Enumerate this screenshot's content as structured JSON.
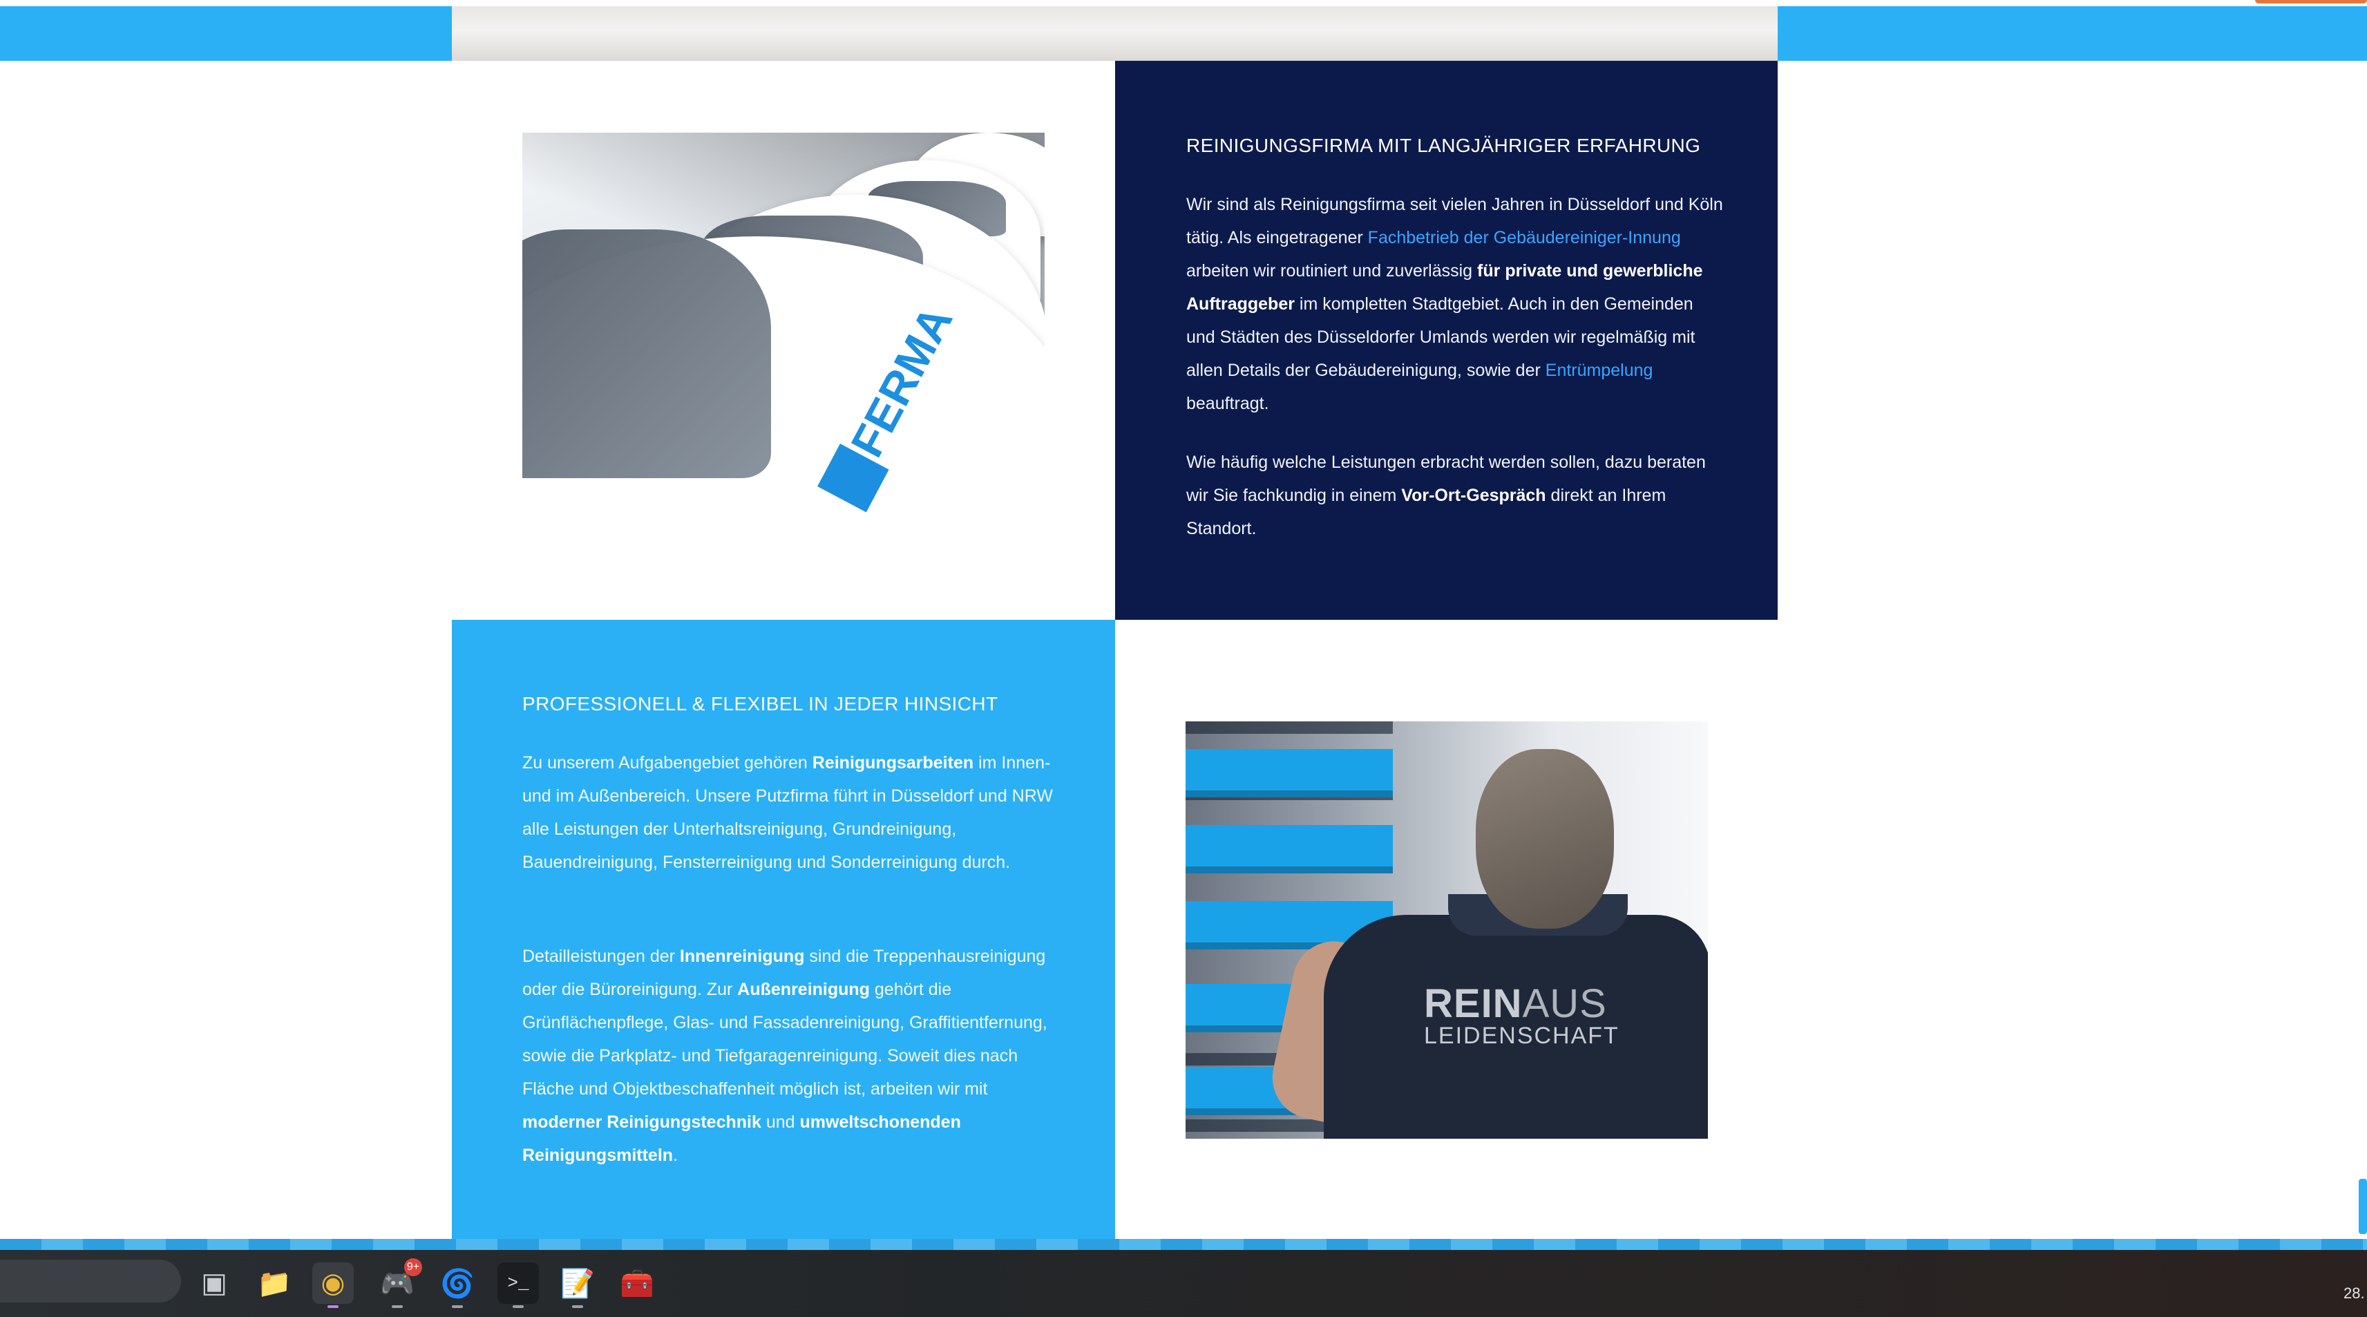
{
  "colors": {
    "accent_blue": "#2bb0f5",
    "navy": "#0c1a4b",
    "link_blue": "#3aa6ff",
    "orange_accent": "#e8763a"
  },
  "section_experience": {
    "heading": "REINIGUNGSFIRMA MIT LANGJÄHRIGER ERFAHRUNG",
    "p1": {
      "t1": "Wir sind als Reinigungsfirma seit vielen Jahren in Düsseldorf und Köln tätig. Als eingetragener ",
      "link1": "Fachbetrieb der Gebäudereiniger-Innung",
      "t2": " arbeiten wir routiniert und zuverlässig ",
      "b1": "für private und gewerbliche Auftraggeber",
      "t3": " im kompletten Stadtgebiet. Auch in den Gemeinden und Städten des Düsseldorfer Umlands werden wir regelmäßig mit allen Details der Gebäudereinigung, sowie der ",
      "link2": "Entrümpelung",
      "t4": " beauftragt."
    },
    "p2": {
      "t1": "Wie häufig welche Leistungen erbracht werden sollen, dazu beraten wir Sie fachkundig in einem ",
      "b1": "Vor-Ort-Gespräch",
      "t2": " direkt an Ihrem Standort."
    }
  },
  "section_professional": {
    "heading": "PROFESSIONELL & FLEXIBEL IN JEDER HINSICHT",
    "p1": {
      "t1": "Zu unserem Aufgabengebiet gehören ",
      "b1": "Reinigungsarbeiten",
      "t2": " im Innen- und im Außenbereich. Unsere Putzfirma führt in Düsseldorf und NRW alle Leistungen der Unterhaltsreinigung, Grundreinigung, Bauendreinigung, Fensterreinigung und Sonderreinigung durch."
    },
    "p2": {
      "t1": "Detailleistungen der ",
      "b1": "Innenreinigung",
      "t2": " sind die Treppenhausreinigung oder die Büroreinigung. Zur ",
      "b2": "Außenreinigung",
      "t3": " gehört die Grünflächenpflege, Glas- und Fassadenreinigung, Graffitientfernung, sowie die Parkplatz- und Tiefgaragenreinigung. Soweit dies nach Fläche und Objektbeschaffenheit möglich ist, arbeiten wir mit ",
      "b3": "moderner Reinigungstechnik",
      "t4": " und ",
      "b4": "umweltschonenden Reinigungsmitteln",
      "t5": "."
    }
  },
  "images": {
    "fleet_logo": "FERMA",
    "worker_shirt_line1_bold": "REIN",
    "worker_shirt_line1_thin": "AUS",
    "worker_shirt_line2": "LEIDENSCHAFT"
  },
  "taskbar": {
    "icons": [
      {
        "name": "task-view-icon",
        "glyph": "▣"
      },
      {
        "name": "file-explorer-icon",
        "glyph": "📁"
      },
      {
        "name": "chrome-icon",
        "glyph": "◉"
      },
      {
        "name": "discord-icon",
        "glyph": "🎮",
        "badge": "9+"
      },
      {
        "name": "app-swirl-icon",
        "glyph": "🌀"
      },
      {
        "name": "terminal-icon",
        "glyph": ">_"
      },
      {
        "name": "editor-icon",
        "glyph": "📝"
      },
      {
        "name": "tool-icon",
        "glyph": "🧰"
      }
    ],
    "clock": "28."
  }
}
